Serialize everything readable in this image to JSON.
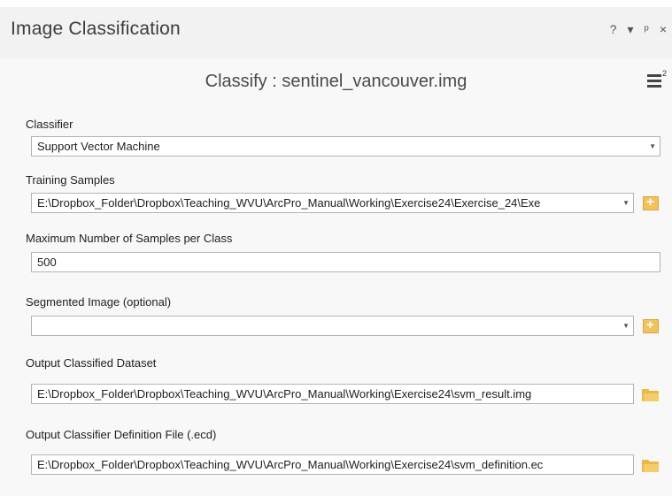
{
  "window": {
    "title": "Image Classification",
    "controls": {
      "help": "?",
      "dropdown": "▾",
      "pin": "⍑",
      "close": "×"
    }
  },
  "tool": {
    "title": "Classify : sentinel_vancouver.img",
    "menu_superscript": "2"
  },
  "params": {
    "classifier": {
      "label": "Classifier",
      "value": "Support Vector Machine"
    },
    "training_samples": {
      "label": "Training Samples",
      "value": "E:\\Dropbox_Folder\\Dropbox\\Teaching_WVU\\ArcPro_Manual\\Working\\Exercise24\\Exercise_24\\Exe"
    },
    "max_samples": {
      "label": "Maximum Number of Samples per Class",
      "value": "500"
    },
    "segmented_image": {
      "label": "Segmented Image (optional)",
      "value": ""
    },
    "output_dataset": {
      "label": "Output Classified Dataset",
      "value": "E:\\Dropbox_Folder\\Dropbox\\Teaching_WVU\\ArcPro_Manual\\Working\\Exercise24\\svm_result.img"
    },
    "output_definition": {
      "label": "Output Classifier Definition File (.ecd)",
      "value": "E:\\Dropbox_Folder\\Dropbox\\Teaching_WVU\\ArcPro_Manual\\Working\\Exercise24\\svm_definition.ec"
    }
  },
  "icons": {
    "add_data": "add-data-icon",
    "browse_folder": "folder-icon",
    "menu": "hamburger-menu-icon"
  }
}
